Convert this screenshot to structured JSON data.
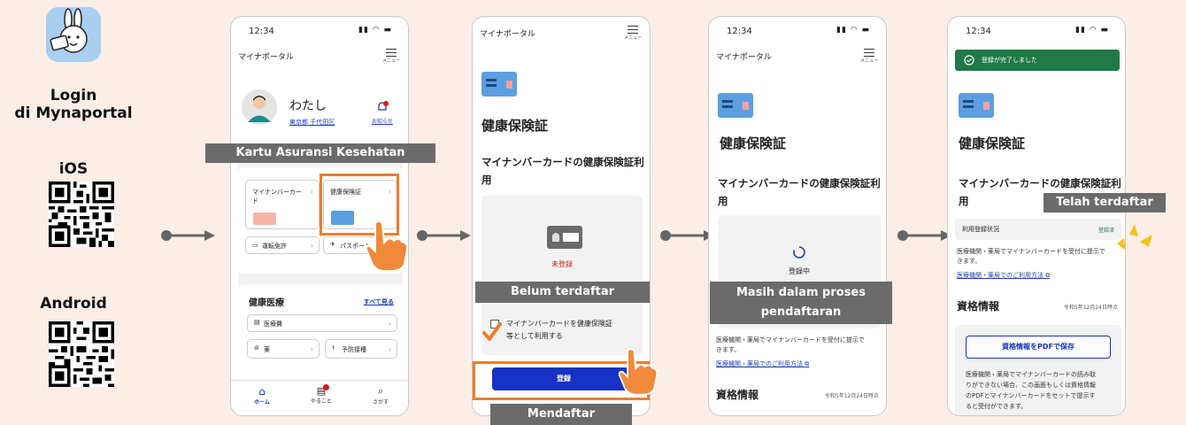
{
  "left": {
    "title_line1": "Login",
    "title_line2": "di Mynaportal",
    "ios_label": "iOS",
    "android_label": "Android"
  },
  "common": {
    "time": "12:34",
    "portal_title": "マイナポータル",
    "menu_label": "メニュー"
  },
  "screen1": {
    "user_name": "わたし",
    "user_location": "東京都 千代田区",
    "notification_label": "お知らせ",
    "tile_mynumber": "マイナンバーカード",
    "tile_insurance": "健康保険証",
    "tile_license": "運転免許",
    "tile_passport": "パスポート",
    "section_title": "健康医療",
    "see_all": "すべて見る",
    "item_medical_cost": "医療費",
    "item_medicine": "薬",
    "item_vaccination": "予防接種",
    "nav_home": "ホーム",
    "nav_todo": "やること",
    "nav_search": "さがす",
    "callout": "Kartu Asuransi Kesehatan"
  },
  "screen2": {
    "title": "健康保険証",
    "subtitle": "マイナンバーカードの健康保険証利用",
    "status": "未登録",
    "checkbox_text_line1": "マイナンバーカードを健康保険証",
    "checkbox_text_line2": "等として利用する",
    "register_button": "登録",
    "callout_unregistered": "Belum terdaftar",
    "callout_register": "Mendaftar"
  },
  "screen3": {
    "title": "健康保険証",
    "subtitle": "マイナンバーカードの健康保険証利用",
    "status": "登録中",
    "info_text_line1": "医療機関・薬局でマイナンバーカードを受付に提示で",
    "info_text_line2": "きます。",
    "info_link": "医療機関・薬局でのご利用方法",
    "section_title": "資格情報",
    "section_date": "令和5年12月24日時点",
    "callout_line1": "Masih dalam proses",
    "callout_line2": "pendaftaran"
  },
  "screen4": {
    "banner": "登録が完了しました",
    "title": "健康保険証",
    "subtitle": "マイナンバーカードの健康保険証利用",
    "status_label": "利用登録状況",
    "status_value": "登録済",
    "info_text_line1": "医療機関・薬局でマイナンバーカードを受付に提示で",
    "info_text_line2": "きます。",
    "info_link": "医療機関・薬局でのご利用方法",
    "section_title": "資格情報",
    "section_date": "令和5年12月24日時点",
    "pdf_button": "資格情報をPDFで保存",
    "pdf_desc_line1": "医療機関・薬局でマイナンバーカードの読み取",
    "pdf_desc_line2": "りができない場合、この画面もしくは資格情報",
    "pdf_desc_line3": "のPDFとマイナンバーカードをセットで提示す",
    "pdf_desc_line4": "ると受付ができます。",
    "callout": "Telah terdaftar"
  },
  "colors": {
    "background": "#fbeee6",
    "accent_orange": "#ee7d2b",
    "callout_gray": "#6b6b6b",
    "button_blue": "#1532c4",
    "success_green": "#1f7a45",
    "error_red": "#d01a1a"
  }
}
